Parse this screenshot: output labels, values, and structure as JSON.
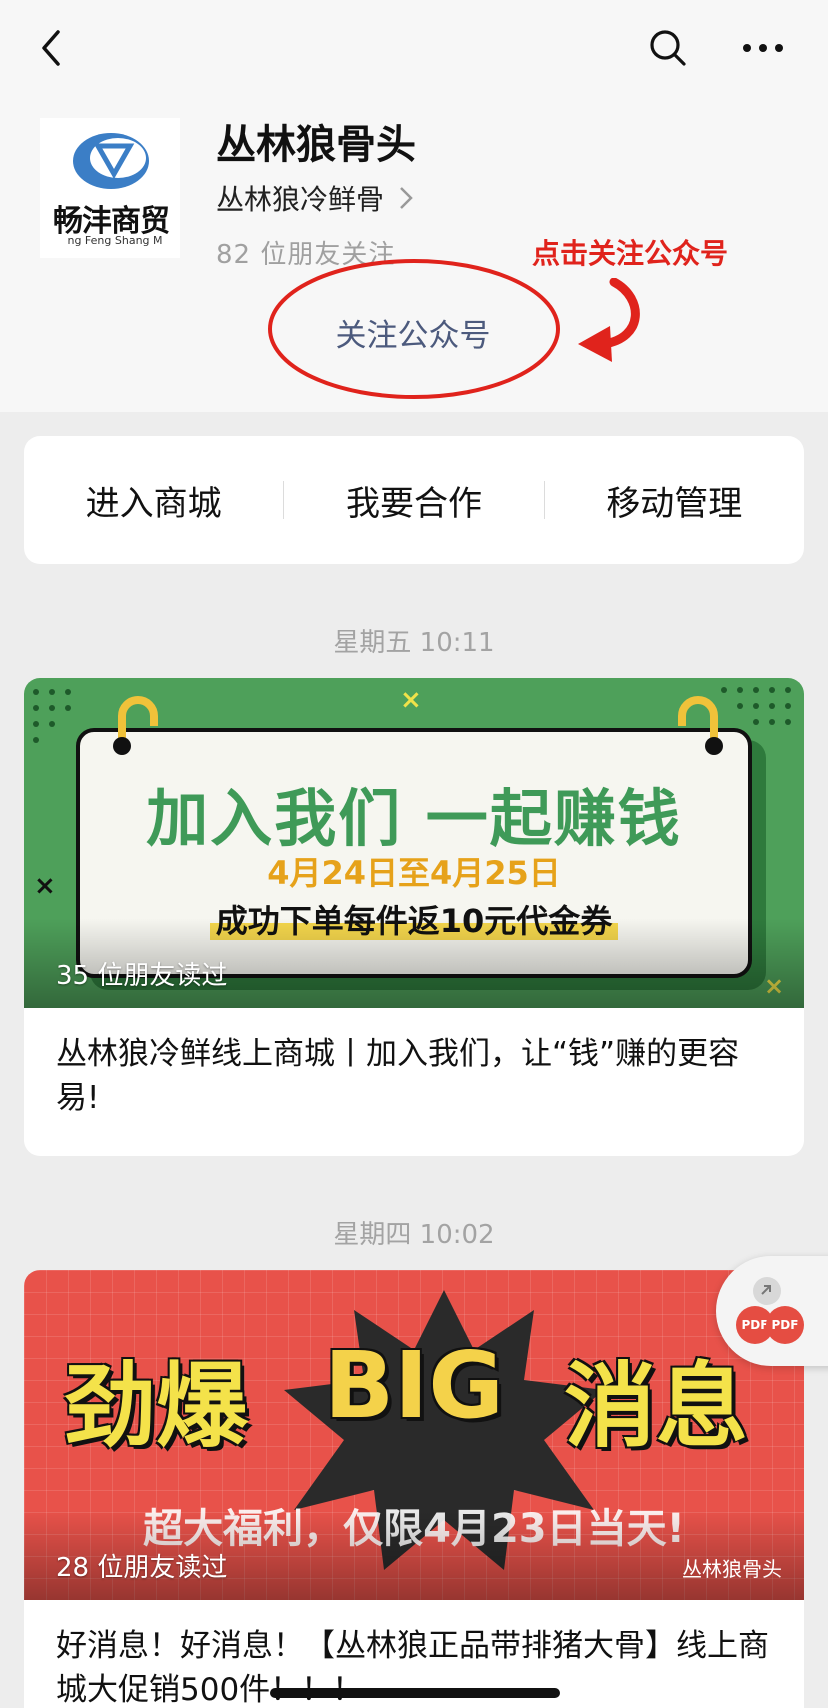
{
  "account": {
    "name": "丛林狼骨头",
    "subtitle": "丛林狼冷鲜骨",
    "followers": "82 位朋友关注",
    "logo_text": "畅沣商贸",
    "logo_sub": "ng Feng Shang M"
  },
  "annotation": {
    "hint": "点击关注公众号"
  },
  "follow_button": "关注公众号",
  "menu": [
    "进入商城",
    "我要合作",
    "移动管理"
  ],
  "articles": [
    {
      "time": "星期五 10:11",
      "cover_main": "加入我们   一起赚钱",
      "cover_date": "4月24日至4月25日",
      "cover_note": "成功下单每件返10元代金券",
      "read_count": "35 位朋友读过",
      "title": "丛林狼冷鲜线上商城丨加入我们，让“钱”赚的更容易!"
    },
    {
      "time": "星期四 10:02",
      "cover_left": "劲爆",
      "cover_big": "BIG",
      "cover_right": "消息",
      "cover_sub": "超大福利，仅限4月23日当天!",
      "watermark": "丛林狼骨头",
      "read_count": "28 位朋友读过",
      "title": "好消息！好消息！【丛林狼正品带排猪大骨】线上商城大促销500件！！！"
    }
  ],
  "float_widget": {
    "label_1": "PDF",
    "label_2": "PDF"
  },
  "colors": {
    "hint_red": "#e0231c",
    "follow_text": "#4c5a7d",
    "background": "#ededed"
  }
}
